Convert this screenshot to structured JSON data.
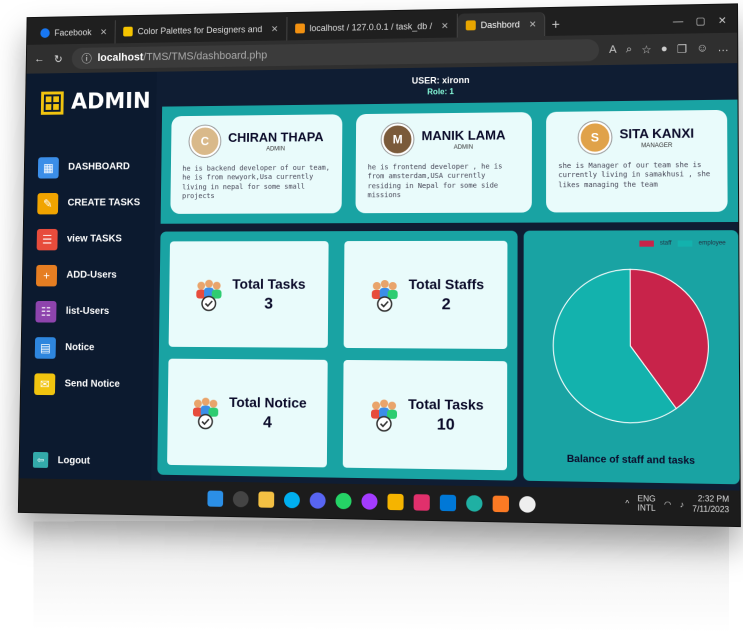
{
  "browser": {
    "tabs": [
      {
        "label": "Facebook",
        "color": "#1877f2"
      },
      {
        "label": "Color Palettes for Designers and",
        "color": "#f5c400"
      },
      {
        "label": "localhost / 127.0.0.1 / task_db / ",
        "color": "#f29111"
      },
      {
        "label": "Dashbord",
        "color": "#e8a600"
      }
    ],
    "url_host": "localhost",
    "url_path": "/TMS/TMS/dashboard.php",
    "window_controls": [
      "—",
      "▢",
      "✕"
    ]
  },
  "sidebar": {
    "brand": "ADMIN",
    "items": [
      {
        "label": "DASHBOARD",
        "icon": "dashboard-icon",
        "color": "#3b8ee8"
      },
      {
        "label": "CREATE TASKS",
        "icon": "clipboard-icon",
        "color": "#f1a400"
      },
      {
        "label": "view TASKS",
        "icon": "list-view-icon",
        "color": "#e74c3c"
      },
      {
        "label": "ADD-Users",
        "icon": "add-user-icon",
        "color": "#e67e22"
      },
      {
        "label": "list-Users",
        "icon": "users-list-icon",
        "color": "#8e44ad"
      },
      {
        "label": "Notice",
        "icon": "calendar-icon",
        "color": "#2e86de"
      },
      {
        "label": "Send Notice",
        "icon": "send-notice-icon",
        "color": "#f1c40f"
      }
    ],
    "logout": "Logout"
  },
  "userbar": {
    "user": "USER: xironn",
    "role": "Role: 1"
  },
  "team": [
    {
      "name": "CHIRAN THAPA",
      "role": "ADMIN",
      "desc": "he is backend developer of our team, he is from newyork,Usa currently living in nepal for some small projects",
      "initial": "C"
    },
    {
      "name": "MANIK LAMA",
      "role": "ADMIN",
      "desc": "he is frontend developer , he is from amsterdam,USA currently residing in Nepal for some side missions",
      "initial": "M"
    },
    {
      "name": "SITA KANXI",
      "role": "MANAGER",
      "desc": "she is Manager of our team she is currently living in samakhusi , she likes managing the team",
      "initial": "S"
    }
  ],
  "stats": [
    {
      "label": "Total Tasks",
      "value": "3"
    },
    {
      "label": "Total Staffs",
      "value": "2"
    },
    {
      "label": "Total Notice",
      "value": "4"
    },
    {
      "label": "Total Tasks",
      "value": "10"
    }
  ],
  "chart_data": {
    "type": "pie",
    "title": "Balance of staff and tasks",
    "legend_position": "top-right",
    "series": [
      {
        "name": "staff",
        "value": 2,
        "color": "#c8234a"
      },
      {
        "name": "employee",
        "value": 3,
        "color": "#13b2ad"
      }
    ]
  },
  "taskbar": {
    "lang": "ENG",
    "lang_sub": "INTL",
    "time": "2:32 PM",
    "date": "7/11/2023",
    "icons": [
      "windows-start-icon",
      "search-icon",
      "file-explorer-icon",
      "skype-icon",
      "discord-icon",
      "whatsapp-icon",
      "messenger-icon",
      "folder-icon",
      "instagram-icon",
      "vscode-icon",
      "edge-icon",
      "xampp-icon",
      "github-icon"
    ]
  }
}
